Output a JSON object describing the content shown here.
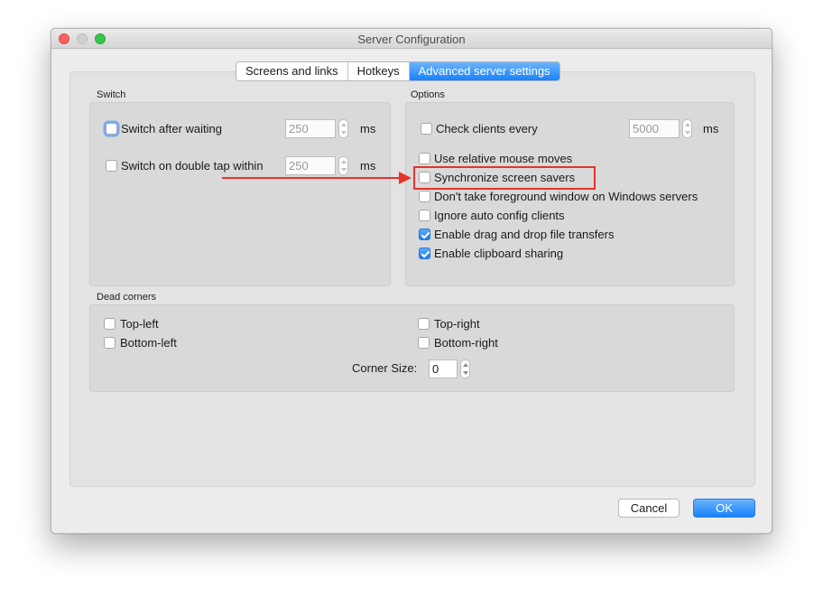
{
  "window": {
    "title": "Server Configuration"
  },
  "tabs": [
    {
      "label": "Screens and links",
      "active": false
    },
    {
      "label": "Hotkeys",
      "active": false
    },
    {
      "label": "Advanced server settings",
      "active": true
    }
  ],
  "switch_group": {
    "title": "Switch",
    "switch_after_waiting": {
      "label": "Switch after waiting",
      "checked": false,
      "value": "250",
      "unit": "ms"
    },
    "switch_double_tap": {
      "label": "Switch on double tap within",
      "checked": false,
      "value": "250",
      "unit": "ms"
    }
  },
  "options_group": {
    "title": "Options",
    "check_clients": {
      "label": "Check clients every",
      "checked": false,
      "value": "5000",
      "unit": "ms"
    },
    "items": [
      {
        "label": "Use relative mouse moves",
        "checked": false
      },
      {
        "label": "Synchronize screen savers",
        "checked": false
      },
      {
        "label": "Don't take foreground window on Windows servers",
        "checked": false
      },
      {
        "label": "Ignore auto config clients",
        "checked": false
      },
      {
        "label": "Enable drag and drop file transfers",
        "checked": true
      },
      {
        "label": "Enable clipboard sharing",
        "checked": true
      }
    ]
  },
  "dead_corners": {
    "title": "Dead corners",
    "top_left": {
      "label": "Top-left",
      "checked": false
    },
    "top_right": {
      "label": "Top-right",
      "checked": false
    },
    "bottom_left": {
      "label": "Bottom-left",
      "checked": false
    },
    "bottom_right": {
      "label": "Bottom-right",
      "checked": false
    },
    "corner_size": {
      "label": "Corner Size:",
      "value": "0"
    }
  },
  "buttons": {
    "cancel": "Cancel",
    "ok": "OK"
  },
  "colors": {
    "accent": "#1a82fb",
    "annotation": "#e8322a",
    "window_bg": "#ececec"
  }
}
